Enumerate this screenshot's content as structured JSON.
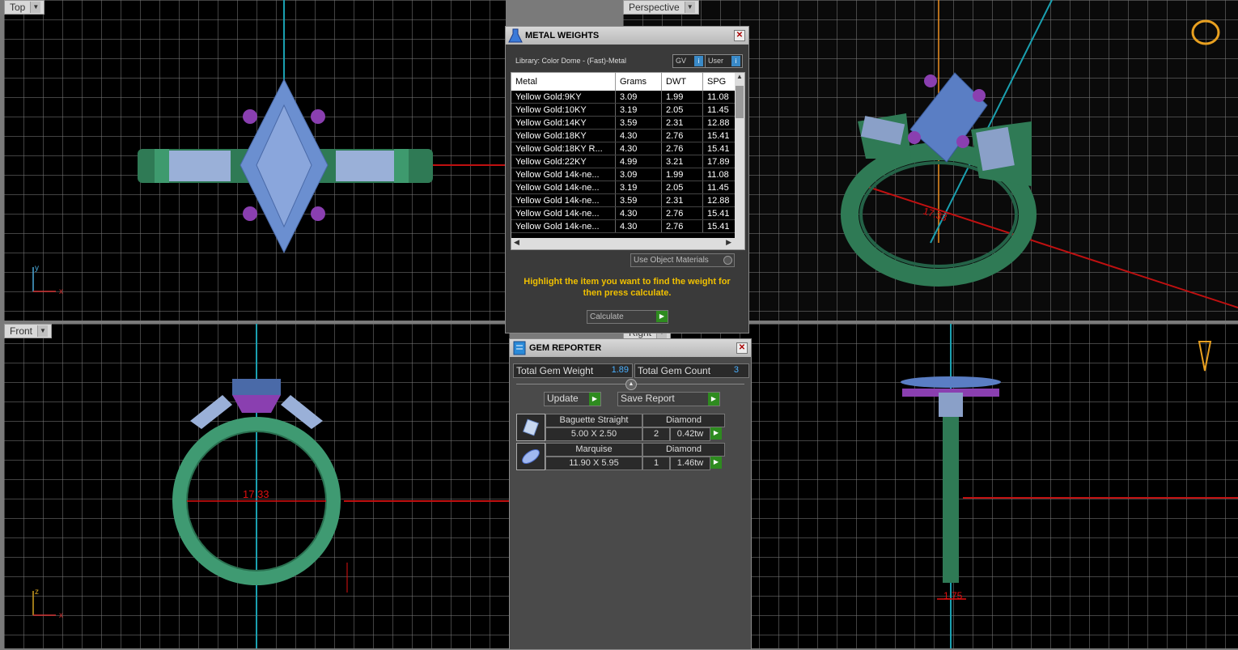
{
  "viewports": {
    "top": {
      "label": "Top",
      "axis_x": "x",
      "axis_y": "y"
    },
    "perspective": {
      "label": "Perspective",
      "dim": "17.33"
    },
    "front": {
      "label": "Front",
      "dim": "17.33",
      "axis_x": "x",
      "axis_z": "z"
    },
    "right": {
      "label": "Right",
      "dim": "1.75"
    }
  },
  "metal_weights": {
    "title": "METAL WEIGHTS",
    "library": "Library: Color Dome - (Fast)-Metal",
    "gv_label": "GV",
    "user_label": "User",
    "columns": [
      "Metal",
      "Grams",
      "DWT",
      "SPG"
    ],
    "rows": [
      [
        "Yellow Gold:9KY",
        "3.09",
        "1.99",
        "11.08"
      ],
      [
        "Yellow Gold:10KY",
        "3.19",
        "2.05",
        "11.45"
      ],
      [
        "Yellow Gold:14KY",
        "3.59",
        "2.31",
        "12.88"
      ],
      [
        "Yellow Gold:18KY",
        "4.30",
        "2.76",
        "15.41"
      ],
      [
        "Yellow Gold:18KY R...",
        "4.30",
        "2.76",
        "15.41"
      ],
      [
        "Yellow Gold:22KY",
        "4.99",
        "3.21",
        "17.89"
      ],
      [
        "Yellow Gold 14k-ne...",
        "3.09",
        "1.99",
        "11.08"
      ],
      [
        "Yellow Gold 14k-ne...",
        "3.19",
        "2.05",
        "11.45"
      ],
      [
        "Yellow Gold 14k-ne...",
        "3.59",
        "2.31",
        "12.88"
      ],
      [
        "Yellow Gold 14k-ne...",
        "4.30",
        "2.76",
        "15.41"
      ],
      [
        "Yellow Gold 14k-ne...",
        "4.30",
        "2.76",
        "15.41"
      ]
    ],
    "use_object_materials": "Use Object Materials",
    "instruction": "Highlight the item you want to find the weight for then press calculate.",
    "calculate_label": "Calculate"
  },
  "gem_reporter": {
    "title": "GEM REPORTER",
    "total_weight_label": "Total Gem Weight",
    "total_weight": "1.89",
    "total_count_label": "Total Gem Count",
    "total_count": "3",
    "update_label": "Update",
    "save_report_label": "Save Report",
    "gems": [
      {
        "shape": "Baguette Straight",
        "material": "Diamond",
        "size": "5.00 X 2.50",
        "count": "2",
        "weight": "0.42tw"
      },
      {
        "shape": "Marquise",
        "material": "Diamond",
        "size": "11.90 X 5.95",
        "count": "1",
        "weight": "1.46tw"
      }
    ]
  },
  "colors": {
    "viewport_bg": "#000000",
    "gem_blue": "#6b8fd0",
    "prong_purple": "#8a3fb0",
    "band_green": "#2e8a5e",
    "dim_red": "#e01010",
    "title_yellow": "#f0c000"
  }
}
